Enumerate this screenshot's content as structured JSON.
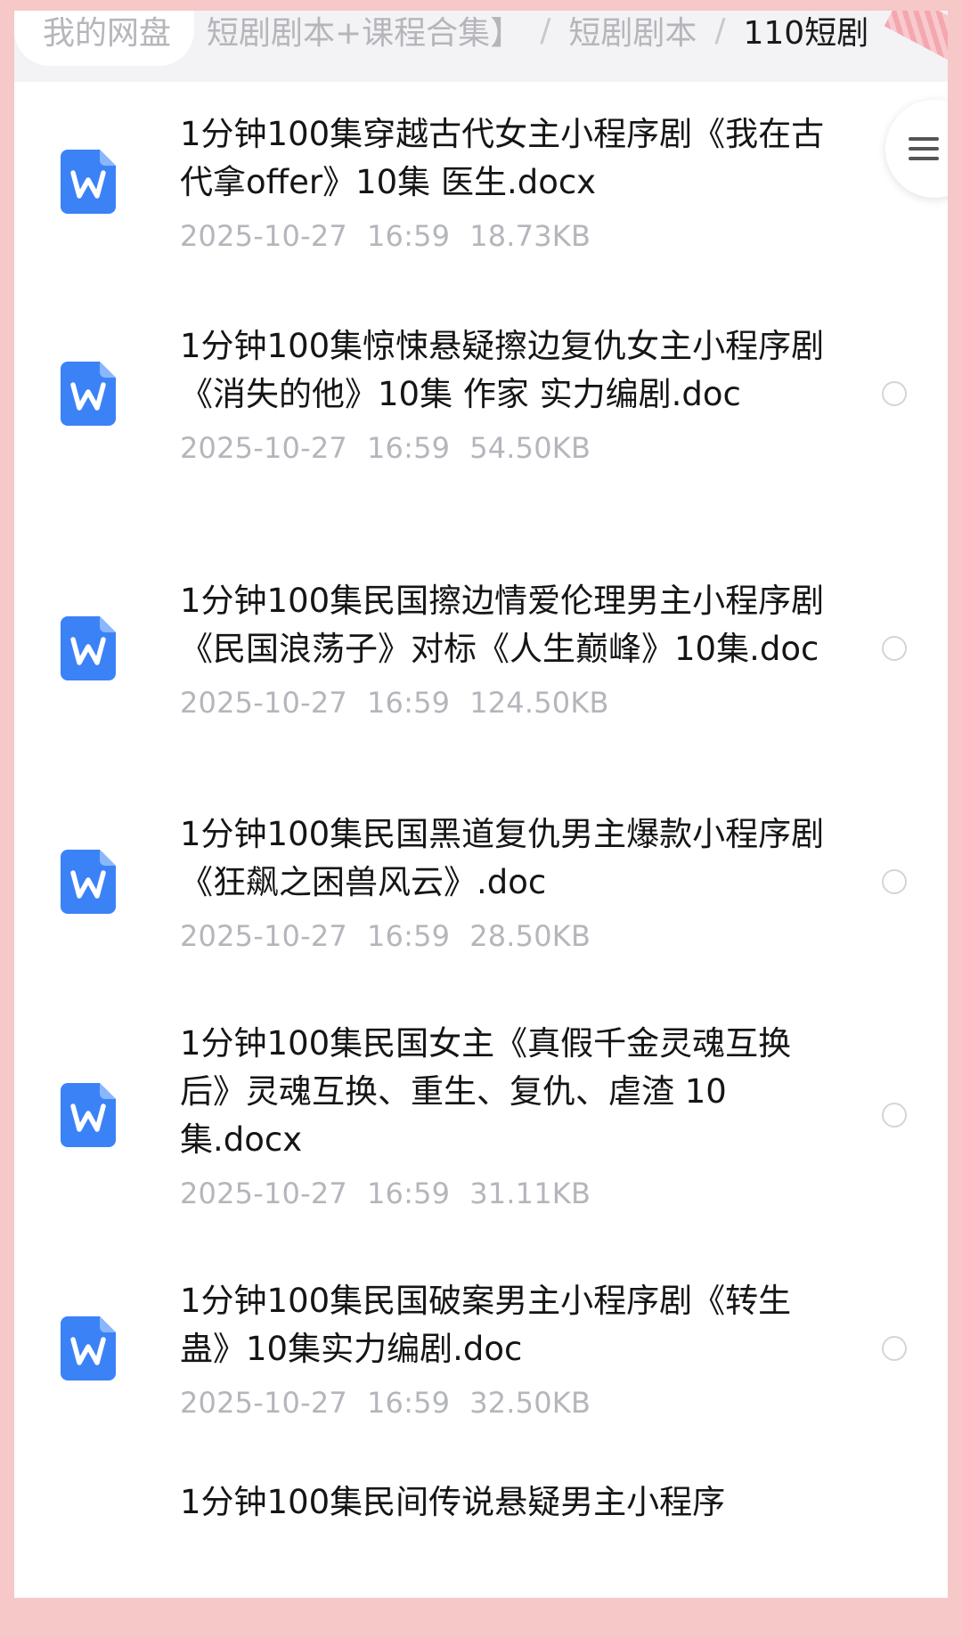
{
  "breadcrumb": {
    "root": "我的网盘",
    "level1": "短剧剧本+课程合集】",
    "sep": "/",
    "level2": "短剧剧本",
    "current": "110短剧"
  },
  "icons": {
    "file": "word-doc-icon",
    "menu": "menu-icon",
    "select": "radio-circle-icon"
  },
  "colors": {
    "word_blue": "#3b82f6",
    "meta_gray": "#b4b6bc",
    "frame_pink": "#f6c8c8"
  },
  "files": [
    {
      "title": "1分钟100集穿越古代女主小程序剧《我在古代拿offer》10集 医生.docx",
      "date": "2025-10-27",
      "time": "16:59",
      "size": "18.73KB"
    },
    {
      "title": "1分钟100集惊悚悬疑擦边复仇女主小程序剧《消失的他》10集 作家 实力编剧.doc",
      "date": "2025-10-27",
      "time": "16:59",
      "size": "54.50KB"
    },
    {
      "title": "1分钟100集民国擦边情爱伦理男主小程序剧《民国浪荡子》对标《人生巅峰》10集.doc",
      "date": "2025-10-27",
      "time": "16:59",
      "size": "124.50KB"
    },
    {
      "title": "1分钟100集民国黑道复仇男主爆款小程序剧《狂飙之困兽风云》.doc",
      "date": "2025-10-27",
      "time": "16:59",
      "size": "28.50KB"
    },
    {
      "title": "1分钟100集民国女主《真假千金灵魂互换后》灵魂互换、重生、复仇、虐渣 10集.docx",
      "date": "2025-10-27",
      "time": "16:59",
      "size": "31.11KB"
    },
    {
      "title": "1分钟100集民国破案男主小程序剧《转生蛊》10集实力编剧.doc",
      "date": "2025-10-27",
      "time": "16:59",
      "size": "32.50KB"
    },
    {
      "title": "1分钟100集民间传说悬疑男主小程序",
      "date": "",
      "time": "",
      "size": ""
    }
  ]
}
